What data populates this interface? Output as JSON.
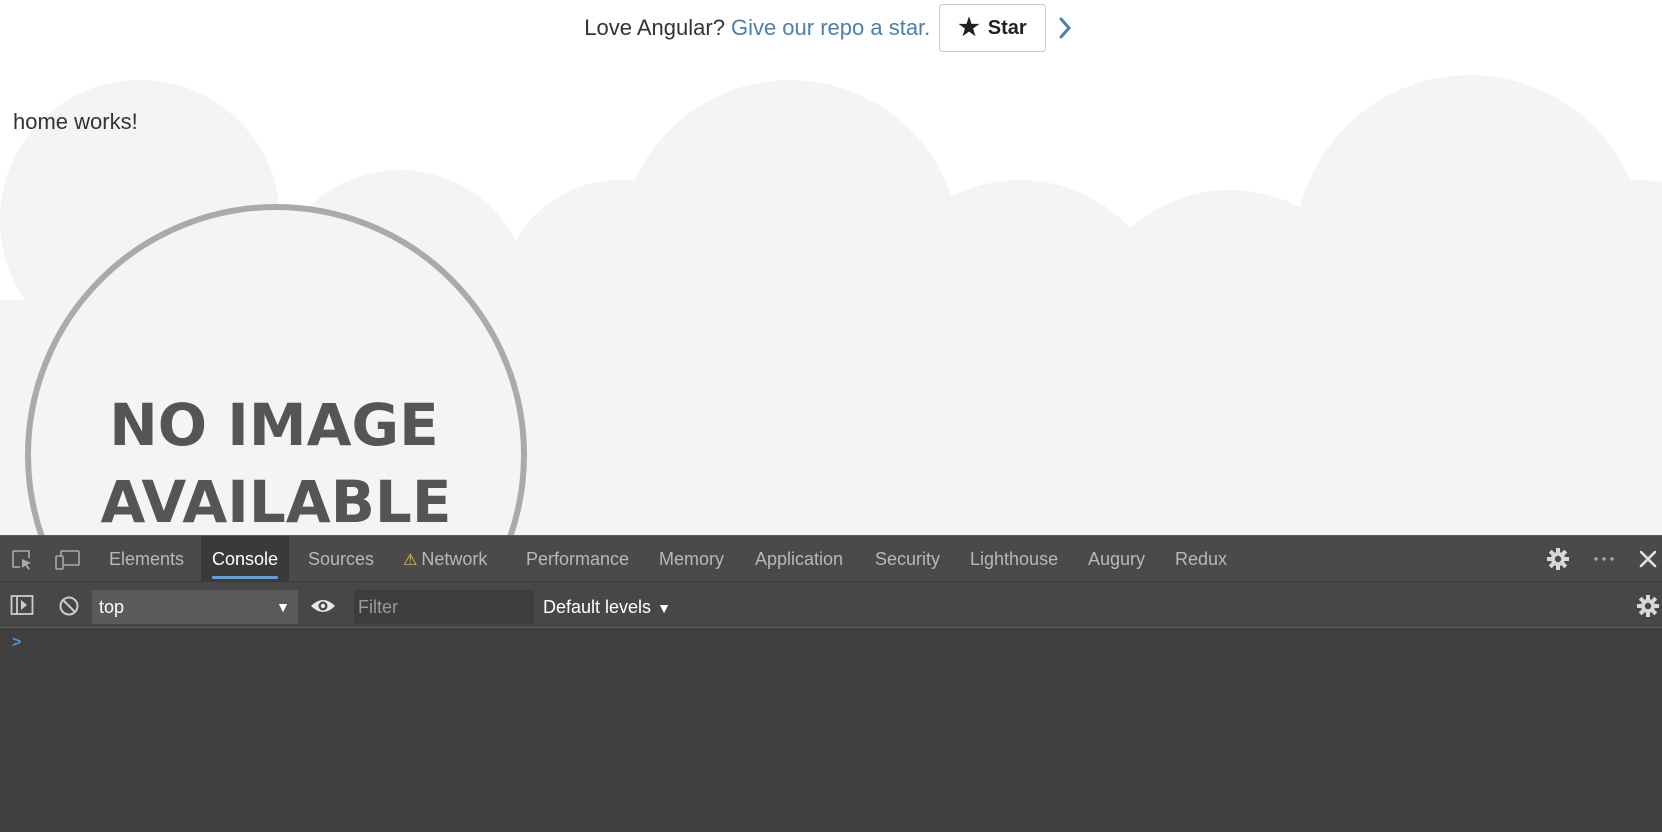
{
  "banner": {
    "message": "Love Angular?",
    "link": "Give our repo a star.",
    "star_button": "Star"
  },
  "page": {
    "home_text": "home works!",
    "placeholder_image": {
      "line1": "NO IMAGE",
      "line2": "AVAILABLE"
    }
  },
  "devtools": {
    "tabs": [
      {
        "label": "Elements"
      },
      {
        "label": "Console",
        "active": true
      },
      {
        "label": "Sources"
      },
      {
        "label": "Network",
        "warning": true
      },
      {
        "label": "Performance"
      },
      {
        "label": "Memory"
      },
      {
        "label": "Application"
      },
      {
        "label": "Security"
      },
      {
        "label": "Lighthouse"
      },
      {
        "label": "Augury"
      },
      {
        "label": "Redux"
      }
    ],
    "toolbar": {
      "context": "top",
      "filter_placeholder": "Filter",
      "levels": "Default levels"
    },
    "prompt": ">"
  },
  "colors": {
    "link": "#4a7fb0",
    "devtools_bg": "#3f3f3f",
    "tab_active_underline": "#5d9fe8",
    "warning": "#f2c53d"
  }
}
